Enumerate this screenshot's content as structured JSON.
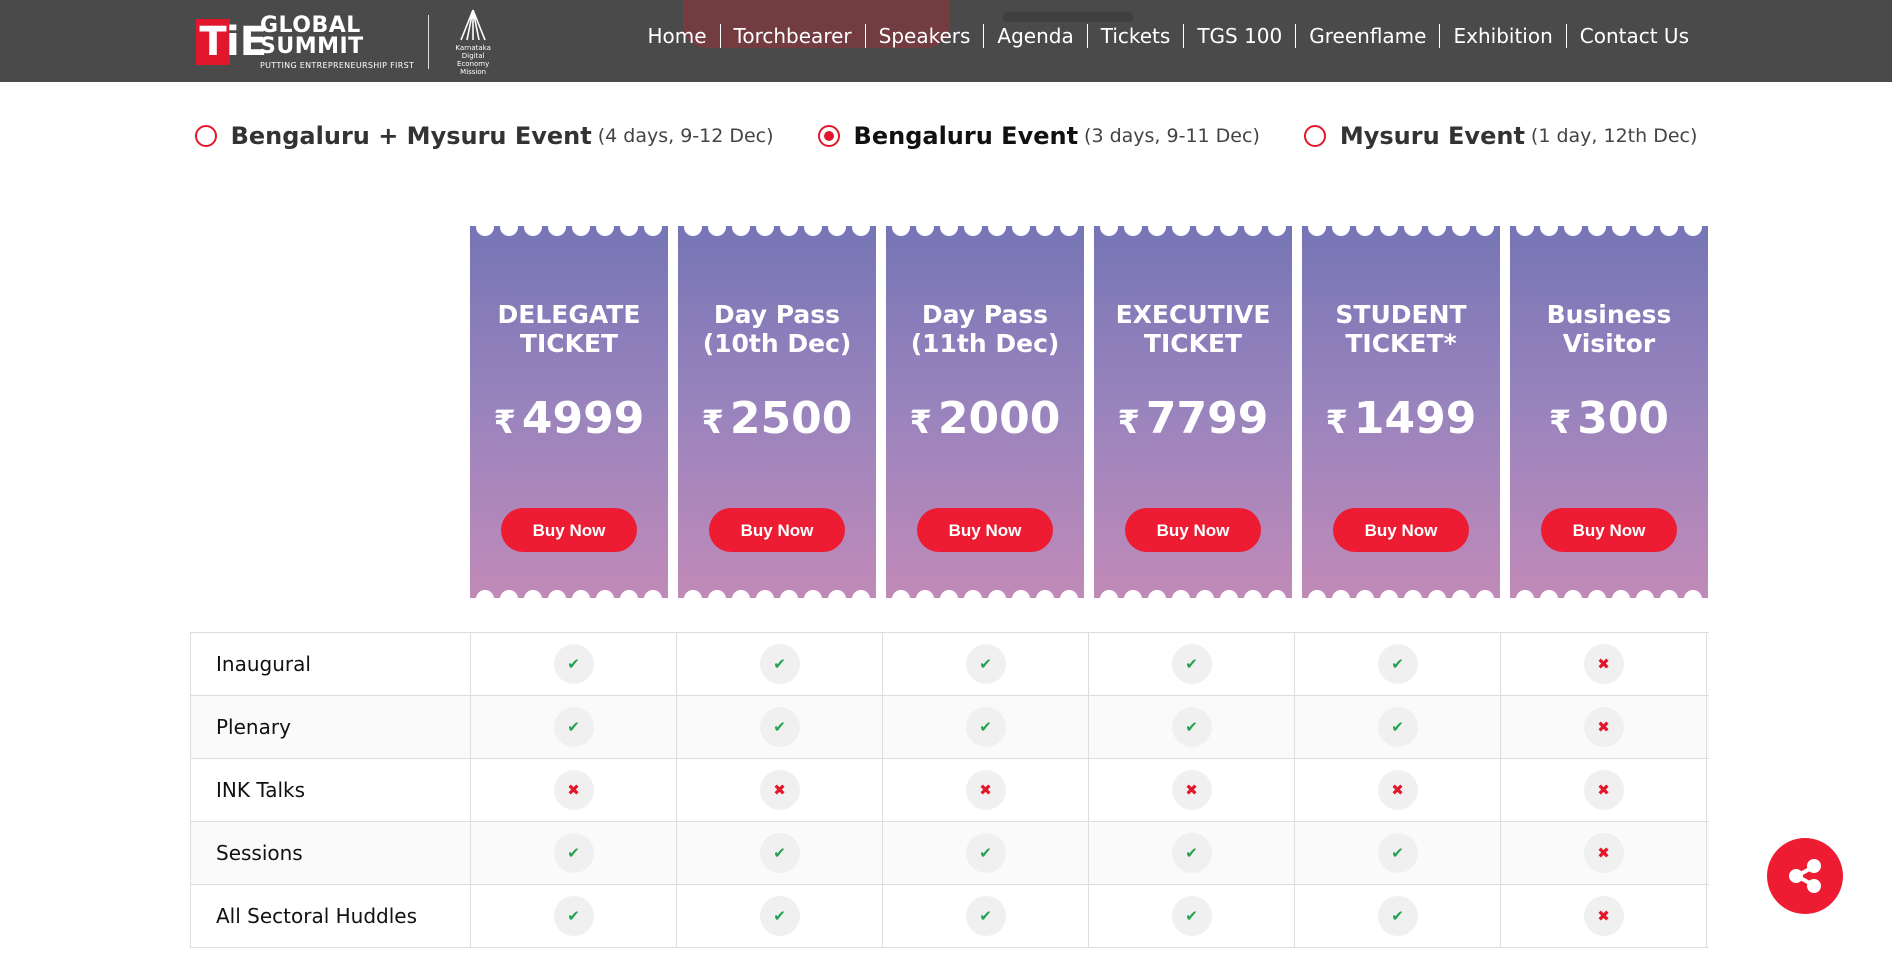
{
  "brand": {
    "logo_t": "T",
    "logo_ie": "iE",
    "name_line1": "GLOBAL",
    "name_line2": "SUMMIT",
    "tagline": "PUTTING ENTREPRENEURSHIP FIRST",
    "partner_line1": "Karnataka Digital",
    "partner_line2": "Economy Mission"
  },
  "nav": {
    "items": [
      "Home",
      "Torchbearer",
      "Speakers",
      "Agenda",
      "Tickets",
      "TGS 100",
      "Greenflame",
      "Exhibition",
      "Contact Us"
    ]
  },
  "events": [
    {
      "name": "Bengaluru + Mysuru Event",
      "sub": "(4 days, 9-12 Dec)",
      "selected": false
    },
    {
      "name": "Bengaluru Event",
      "sub": "(3 days, 9-11 Dec)",
      "selected": true
    },
    {
      "name": "Mysuru Event",
      "sub": "(1 day, 12th Dec)",
      "selected": false
    }
  ],
  "currency_symbol": "₹",
  "tickets": [
    {
      "title_line1": "DELEGATE",
      "title_line2": "TICKET",
      "price": "4999",
      "button": "Buy Now"
    },
    {
      "title_line1": "Day Pass",
      "title_line2": "(10th Dec)",
      "price": "2500",
      "button": "Buy Now"
    },
    {
      "title_line1": "Day Pass",
      "title_line2": "(11th Dec)",
      "price": "2000",
      "button": "Buy Now"
    },
    {
      "title_line1": "EXECUTIVE",
      "title_line2": "TICKET",
      "price": "7799",
      "button": "Buy Now"
    },
    {
      "title_line1": "STUDENT",
      "title_line2": "TICKET*",
      "price": "1499",
      "button": "Buy Now"
    },
    {
      "title_line1": "Business",
      "title_line2": "Visitor",
      "price": "300",
      "button": "Buy Now"
    }
  ],
  "features": [
    {
      "label": "Inaugural",
      "values": [
        true,
        true,
        true,
        true,
        true,
        false
      ]
    },
    {
      "label": "Plenary",
      "values": [
        true,
        true,
        true,
        true,
        true,
        false
      ]
    },
    {
      "label": "INK Talks",
      "values": [
        false,
        false,
        false,
        false,
        false,
        false
      ]
    },
    {
      "label": "Sessions",
      "values": [
        true,
        true,
        true,
        true,
        true,
        false
      ]
    },
    {
      "label": "All Sectoral Huddles",
      "values": [
        true,
        true,
        true,
        true,
        true,
        false
      ]
    }
  ],
  "colors": {
    "accent": "#e3172c",
    "header_bg": "#4a4a4a",
    "card_gradient_top": "#7675b5",
    "card_gradient_bottom": "#c18ab8",
    "check": "#23a24d",
    "cross": "#e3172c"
  },
  "icons": {
    "check": "check-icon",
    "cross": "cross-icon",
    "share": "share-icon",
    "radio": "radio-icon"
  }
}
